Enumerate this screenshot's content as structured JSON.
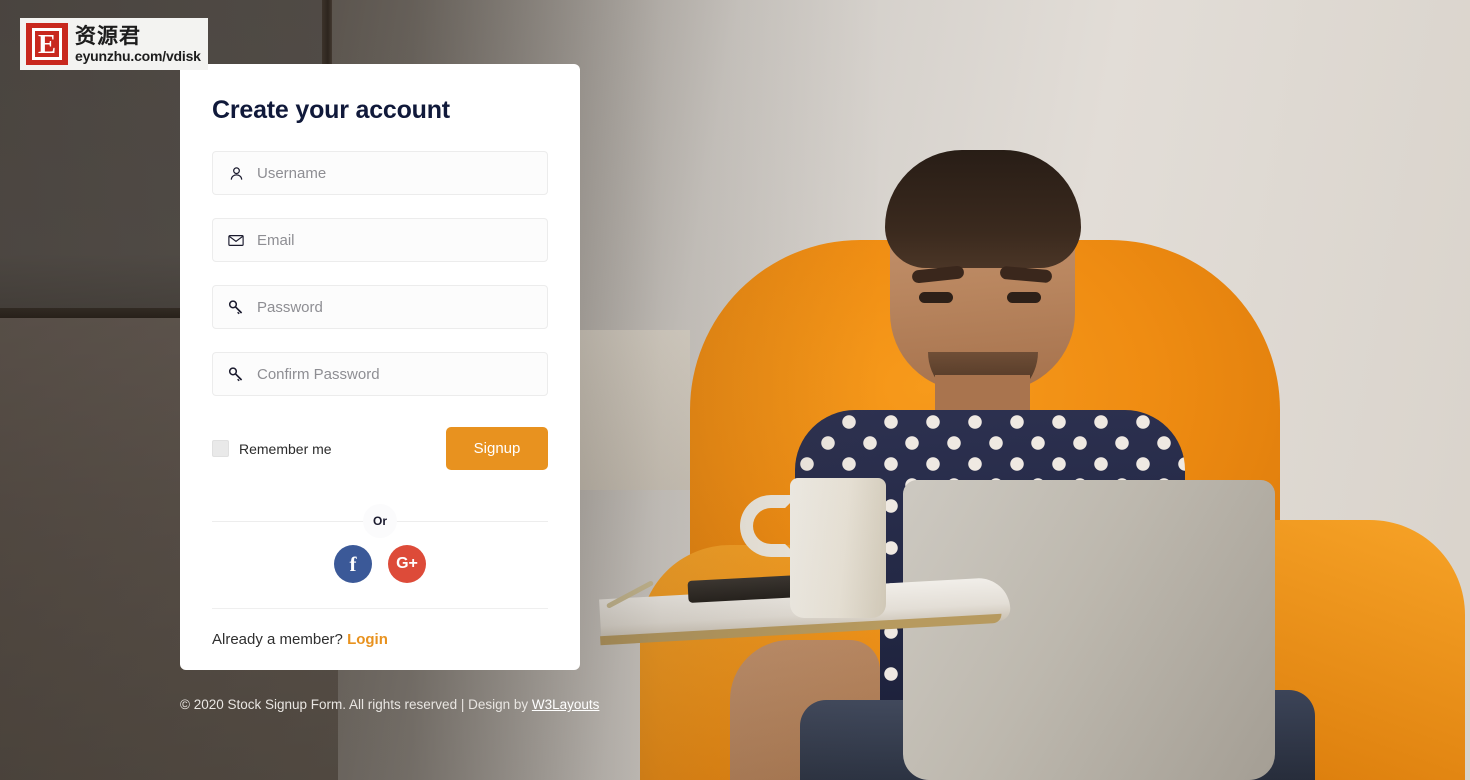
{
  "watermark": {
    "badge_letter": "E",
    "chinese_text": "资源君",
    "url_text": "eyunzhu.com/vdisk"
  },
  "card": {
    "title": "Create your account",
    "fields": [
      {
        "name": "username",
        "icon": "user-icon",
        "placeholder": "Username",
        "value": "",
        "type": "text"
      },
      {
        "name": "email",
        "icon": "envelope-icon",
        "placeholder": "Email",
        "value": "",
        "type": "email"
      },
      {
        "name": "password",
        "icon": "key-icon",
        "placeholder": "Password",
        "value": "",
        "type": "password"
      },
      {
        "name": "confirm_password",
        "icon": "key-icon",
        "placeholder": "Confirm Password",
        "value": "",
        "type": "password"
      }
    ],
    "remember_label": "Remember me",
    "remember_checked": false,
    "signup_label": "Signup",
    "or_label": "Or",
    "socials": [
      {
        "name": "facebook",
        "glyph": "f",
        "color": "#3b5998"
      },
      {
        "name": "google-plus",
        "glyph": "G+",
        "color": "#dd4b39"
      }
    ],
    "member_prompt": "Already a member? ",
    "login_label": "Login"
  },
  "footer": {
    "text": "© 2020 Stock Signup Form. All rights reserved | Design by ",
    "link_label": "W3Layouts"
  },
  "colors": {
    "accent": "#e8921f",
    "title": "#10193a",
    "facebook": "#3b5998",
    "google": "#dd4b39",
    "card_bg": "#ffffff"
  }
}
